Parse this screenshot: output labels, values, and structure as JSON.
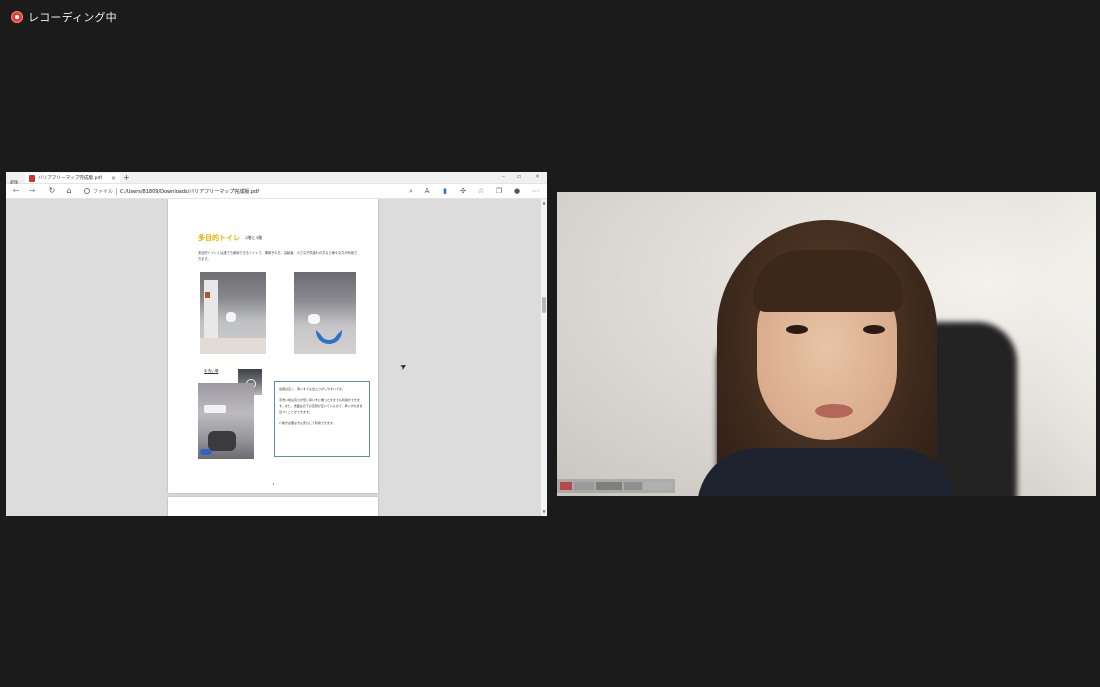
{
  "recording": {
    "label": "レコーディング中",
    "indicator_color": "#d8453c"
  },
  "browser": {
    "tab_title": "バリアフリーマップ完成版.pdf",
    "new_tab_symbol": "+",
    "close_symbol": "×",
    "window_controls": [
      "–",
      "▫",
      "×"
    ],
    "address": {
      "scheme_label": "ファイル",
      "path": "C:/Users/81809/Downloads/バリアフリーマップ完成版.pdf"
    },
    "toolbar_icons": [
      "zoom-icon",
      "read-aloud-icon",
      "extensions-icon",
      "puzzle-icon",
      "refresh-sync-icon",
      "favorites-icon",
      "collections-icon",
      "profile-icon",
      "more-icon"
    ]
  },
  "document": {
    "title": "多目的トイレ",
    "floor": "2階と3階",
    "intro": "多目的トイレとは誰でも使用できるトイレで、車椅子の方、高齢者、小さな子供連れの方など様々な方が利用できます。",
    "handwash_label": "手洗い場",
    "box_text": [
      "扉幅は広く、車いすでも出入りがしやすいです。",
      "手洗い場は高さが低く車いすに乗ったままでも利用ができます。また、洗面台の下の空間が空いているので、車いすのまま近づくことができます。",
      "介助が必要な方も安心して利用できます。"
    ],
    "page_number": "1"
  },
  "camera": {
    "participant_name": ""
  }
}
